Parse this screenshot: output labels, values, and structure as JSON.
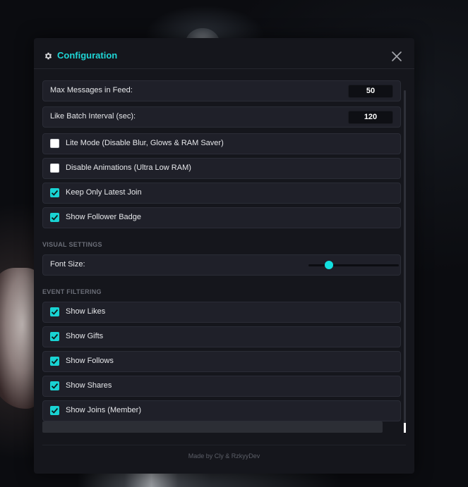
{
  "header": {
    "title": "Configuration"
  },
  "settings": {
    "max_messages_label": "Max Messages in Feed:",
    "max_messages_value": "50",
    "like_batch_label": "Like Batch Interval (sec):",
    "like_batch_value": "120",
    "toggles": [
      {
        "label": "Lite Mode (Disable Blur, Glows & RAM Saver)",
        "checked": false
      },
      {
        "label": "Disable Animations (Ultra Low RAM)",
        "checked": false
      },
      {
        "label": "Keep Only Latest Join",
        "checked": true
      },
      {
        "label": "Show Follower Badge",
        "checked": true
      }
    ]
  },
  "visual": {
    "section_title": "VISUAL SETTINGS",
    "font_size_label": "Font Size:",
    "font_size_fraction": 0.2
  },
  "events": {
    "section_title": "EVENT FILTERING",
    "filters": [
      {
        "label": "Show Likes",
        "checked": true
      },
      {
        "label": "Show Gifts",
        "checked": true
      },
      {
        "label": "Show Follows",
        "checked": true
      },
      {
        "label": "Show Shares",
        "checked": true
      },
      {
        "label": "Show Joins (Member)",
        "checked": true
      }
    ]
  },
  "footer": {
    "credit": "Made by Cly & RzkyyDev"
  },
  "colors": {
    "accent": "#19d3d3",
    "panel": "#15161c",
    "row": "#1f2029"
  },
  "icons": {
    "settings": "gear-icon",
    "close": "close-icon",
    "check": "checkmark-icon"
  }
}
